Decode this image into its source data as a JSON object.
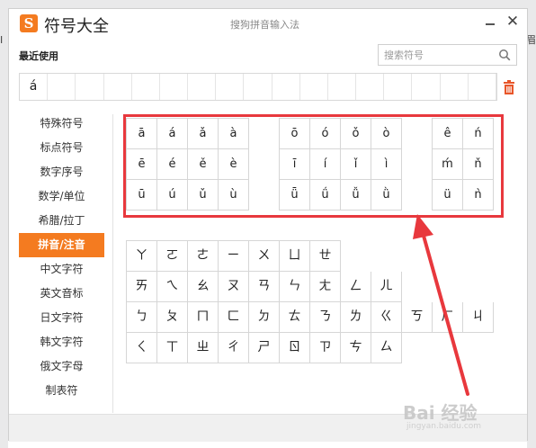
{
  "window": {
    "app_title": "符号大全",
    "ime_title": "搜狗拼音输入法",
    "logo_letter": "S",
    "close_glyph": "✕"
  },
  "background": {
    "left_fragment": "Ⅰ",
    "right_fragment": "眉"
  },
  "recent": {
    "label": "最近使用",
    "items": [
      "á",
      "",
      "",
      "",
      "",
      "",
      "",
      "",
      "",
      "",
      "",
      "",
      "",
      "",
      "",
      "",
      ""
    ]
  },
  "search": {
    "placeholder": "搜索符号"
  },
  "sidebar": {
    "items": [
      {
        "label": "特殊符号",
        "active": false
      },
      {
        "label": "标点符号",
        "active": false
      },
      {
        "label": "数字序号",
        "active": false
      },
      {
        "label": "数学/单位",
        "active": false
      },
      {
        "label": "希腊/拉丁",
        "active": false
      },
      {
        "label": "拼音/注音",
        "active": true
      },
      {
        "label": "中文字符",
        "active": false
      },
      {
        "label": "英文音标",
        "active": false
      },
      {
        "label": "日文字符",
        "active": false
      },
      {
        "label": "韩文字符",
        "active": false
      },
      {
        "label": "俄文字母",
        "active": false
      },
      {
        "label": "制表符",
        "active": false
      }
    ]
  },
  "pinyin_groups": [
    {
      "rows": [
        [
          "ā",
          "á",
          "ǎ",
          "à"
        ],
        [
          "ē",
          "é",
          "ě",
          "è"
        ],
        [
          "ū",
          "ú",
          "ǔ",
          "ù"
        ]
      ]
    },
    {
      "rows": [
        [
          "ō",
          "ó",
          "ǒ",
          "ò"
        ],
        [
          "ī",
          "í",
          "ǐ",
          "ì"
        ],
        [
          "ǖ",
          "ǘ",
          "ǚ",
          "ǜ"
        ]
      ]
    },
    {
      "rows": [
        [
          "ê",
          "ń"
        ],
        [
          "ḿ",
          "ň"
        ],
        [
          "ü",
          "ǹ"
        ]
      ]
    }
  ],
  "zhuyin_rows": [
    [
      "ㄚ",
      "ㄛ",
      "ㄜ",
      "ㄧ",
      "ㄨ",
      "ㄩ",
      "ㄝ"
    ],
    [
      "ㄞ",
      "ㄟ",
      "ㄠ",
      "ㄡ",
      "ㄢ",
      "ㄣ",
      "ㄤ",
      "ㄥ",
      "ㄦ"
    ],
    [
      "ㄅ",
      "ㄆ",
      "ㄇ",
      "ㄈ",
      "ㄉ",
      "ㄊ",
      "ㄋ",
      "ㄌ",
      "ㄍ",
      "ㄎ",
      "ㄏ",
      "ㄐ"
    ],
    [
      "ㄑ",
      "ㄒ",
      "ㄓ",
      "ㄔ",
      "ㄕ",
      "ㄖ",
      "ㄗ",
      "ㄘ",
      "ㄙ"
    ]
  ],
  "watermark": {
    "main": "Bai 经验",
    "sub": "jingyan.baidu.com"
  },
  "colors": {
    "accent": "#f47b20",
    "highlight": "#e8383d"
  }
}
